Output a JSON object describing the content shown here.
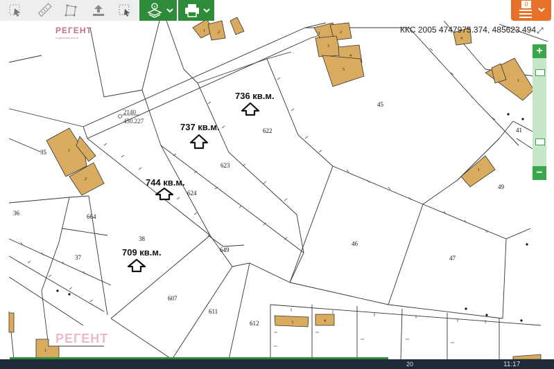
{
  "toolbar": {
    "tools": [
      {
        "name": "select-pointer-icon"
      },
      {
        "name": "measure-ruler-icon"
      },
      {
        "name": "area-polygon-icon"
      },
      {
        "name": "export-upload-icon"
      },
      {
        "name": "select-area-icon"
      }
    ],
    "info_layers_button": {
      "icon": "info-layers-icon"
    },
    "print_button": {
      "icon": "printer-icon"
    },
    "menu_button": {
      "badge": "0",
      "icon": "hamburger-menu-icon"
    }
  },
  "coordinates": "ККС 2005 4747975.374, 485623.494",
  "logo": {
    "name": "РЕГЕНТ",
    "tagline": "недвижими имоти"
  },
  "watermark": "РЕГЕНТ",
  "zoom": {
    "plus": "+",
    "minus": "−"
  },
  "listings": [
    {
      "area": "736 кв.м."
    },
    {
      "area": "737 кв.м."
    },
    {
      "area": "744 кв.м."
    },
    {
      "area": "709 кв.м."
    }
  ],
  "parcel_labels": [
    "622",
    "623",
    "624",
    "45",
    "41",
    "49",
    "46",
    "47",
    "35",
    "36",
    "664",
    "37",
    "38",
    "649",
    "607",
    "611",
    "612"
  ],
  "building_labels": [
    "1",
    "2",
    "1",
    "2",
    "1",
    "2",
    "3",
    "4",
    "5",
    "4",
    "1",
    "1",
    "3",
    "4",
    "1"
  ],
  "elevation": {
    "point": "2140",
    "value": "450.227"
  },
  "taskbar": {
    "time": "11:17",
    "left_text": "20"
  },
  "colors": {
    "building": "#d9ab5e",
    "toolbar_green": "#2e8b3a",
    "menu_orange": "#e8712a",
    "parcel_line": "#222222",
    "road_line": "#555555"
  }
}
